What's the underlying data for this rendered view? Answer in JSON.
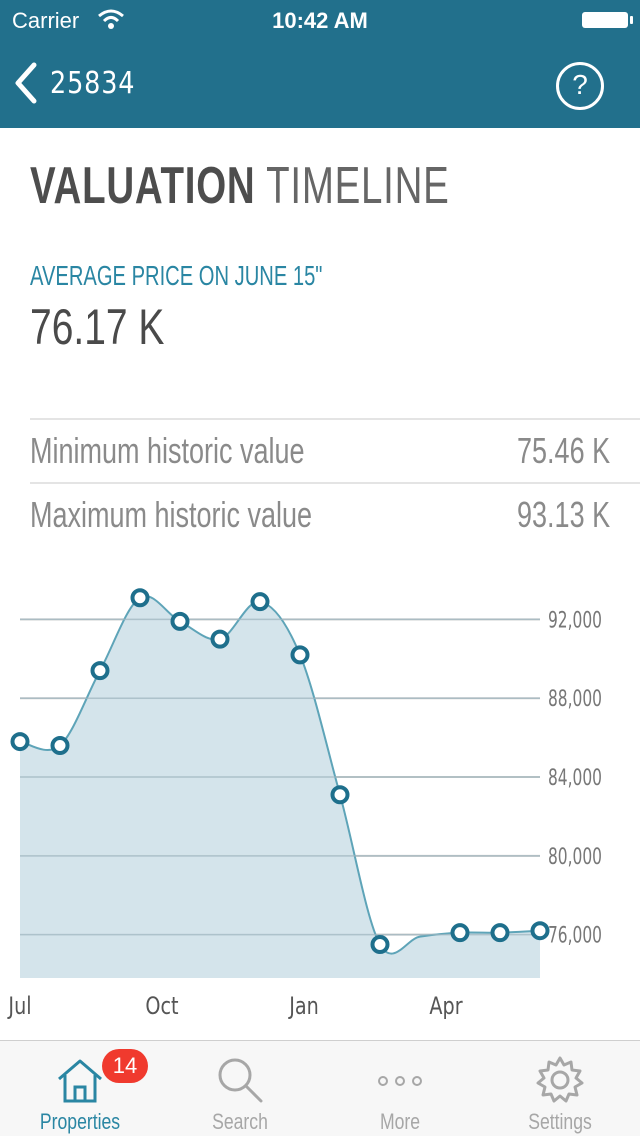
{
  "status_bar": {
    "carrier": "Carrier",
    "time": "10:42 AM"
  },
  "nav": {
    "back_label": "25834",
    "help_label": "?"
  },
  "title": {
    "bold": "VALUATION",
    "light": "TIMELINE"
  },
  "average": {
    "label": "AVERAGE PRICE ON JUNE 15\"",
    "value": "76.17 K"
  },
  "stats": [
    {
      "label": "Minimum historic value",
      "value": "75.46 K"
    },
    {
      "label": "Maximum historic value",
      "value": "93.13 K"
    }
  ],
  "chart_data": {
    "type": "area",
    "x_tick_labels": [
      "Jul",
      "Oct",
      "Jan",
      "Apr"
    ],
    "y_tick_labels": [
      "92,000",
      "88,000",
      "84,000",
      "80,000",
      "76,000"
    ],
    "y_ticks": [
      92000,
      88000,
      84000,
      80000,
      76000
    ],
    "ylim": [
      73800,
      94000
    ],
    "grid": true,
    "line_color": "#5ea4b8",
    "fill_color": "#cfe1e9",
    "marker_color": "#1e6f8c",
    "series": [
      {
        "x": [
          0,
          1,
          2,
          3,
          4,
          5,
          6,
          7,
          8,
          9,
          10,
          11,
          12,
          13
        ],
        "values": [
          85800,
          85600,
          89400,
          93100,
          91900,
          91000,
          92900,
          90200,
          83100,
          75500,
          75900,
          76100,
          76100,
          76200
        ],
        "markers": [
          true,
          true,
          true,
          true,
          true,
          true,
          true,
          true,
          true,
          true,
          false,
          true,
          true,
          true
        ]
      }
    ]
  },
  "tabs": [
    {
      "label": "Properties",
      "icon": "home-icon",
      "badge": "14",
      "active": true
    },
    {
      "label": "Search",
      "icon": "search-icon"
    },
    {
      "label": "More",
      "icon": "more-icon"
    },
    {
      "label": "Settings",
      "icon": "gear-icon"
    }
  ],
  "colors": {
    "accent": "#22708c",
    "badge": "#f03a2e",
    "label_accent": "#2a86a3"
  }
}
